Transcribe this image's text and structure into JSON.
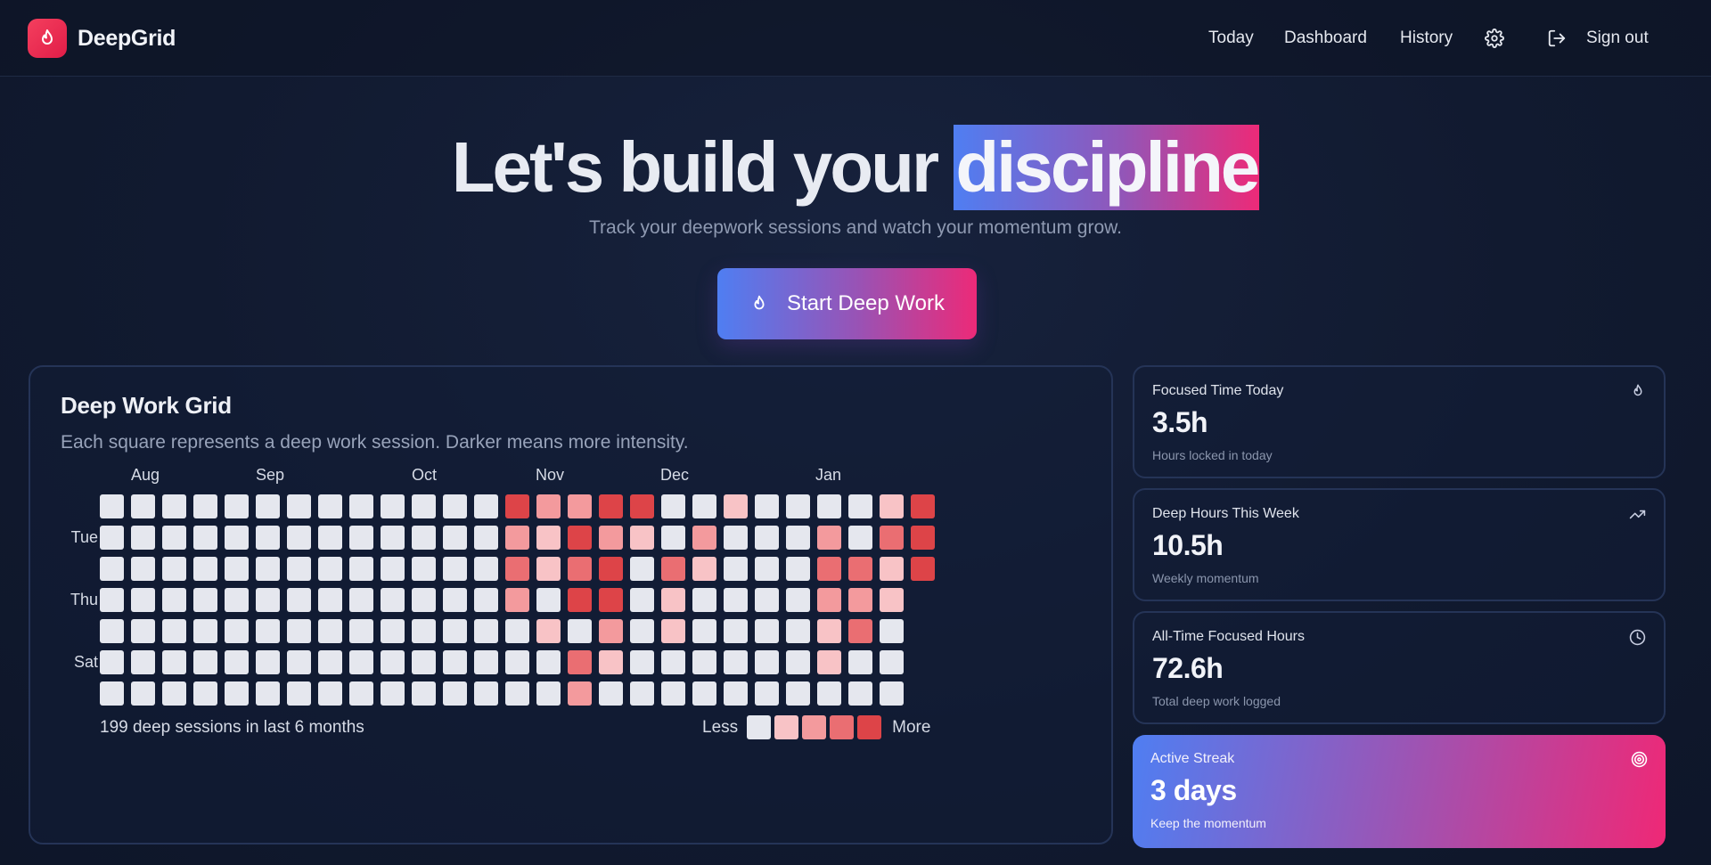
{
  "header": {
    "brand": "DeepGrid",
    "nav": [
      {
        "label": "Today"
      },
      {
        "label": "Dashboard"
      },
      {
        "label": "History"
      }
    ],
    "settings_icon": "gear-icon",
    "signout_icon": "sign-out-icon",
    "signout_label": "Sign out"
  },
  "hero": {
    "title_prefix": "Let's build your",
    "title_highlight": "discipline",
    "subtitle": "Track your deepwork sessions and watch your momentum grow.",
    "cta_label": "Start Deep Work",
    "cta_icon": "flame-icon"
  },
  "grid": {
    "title": "Deep Work Grid",
    "description": "Each square represents a deep work session. Darker means more intensity.",
    "months": [
      "Aug",
      "Sep",
      "Oct",
      "Nov",
      "Dec",
      "Jan"
    ],
    "day_labels": [
      "",
      "Tue",
      "",
      "Thu",
      "",
      "Sat",
      ""
    ],
    "summary": "199 deep sessions in last 6 months",
    "legend_less": "Less",
    "legend_more": "More",
    "levels": [
      "#e5e7ee",
      "#f8c3c6",
      "#f39a9d",
      "#ea6e72",
      "#dd4448"
    ],
    "weeks": [
      [
        0,
        0,
        0,
        0,
        0,
        0,
        0
      ],
      [
        0,
        0,
        0,
        0,
        0,
        0,
        0
      ],
      [
        0,
        0,
        0,
        0,
        0,
        0,
        0
      ],
      [
        0,
        0,
        0,
        0,
        0,
        0,
        0
      ],
      [
        0,
        0,
        0,
        0,
        0,
        0,
        0
      ],
      [
        0,
        0,
        0,
        0,
        0,
        0,
        0
      ],
      [
        0,
        0,
        0,
        0,
        0,
        0,
        0
      ],
      [
        0,
        0,
        0,
        0,
        0,
        0,
        0
      ],
      [
        0,
        0,
        0,
        0,
        0,
        0,
        0
      ],
      [
        0,
        0,
        0,
        0,
        0,
        0,
        0
      ],
      [
        0,
        0,
        0,
        0,
        0,
        0,
        0
      ],
      [
        0,
        0,
        0,
        0,
        0,
        0,
        0
      ],
      [
        0,
        0,
        0,
        0,
        0,
        0,
        0
      ],
      [
        4,
        2,
        3,
        2,
        0,
        0,
        0
      ],
      [
        2,
        1,
        1,
        0,
        1,
        0,
        0
      ],
      [
        2,
        4,
        3,
        4,
        0,
        3,
        2
      ],
      [
        4,
        2,
        4,
        4,
        2,
        1,
        0
      ],
      [
        4,
        1,
        0,
        0,
        0,
        0,
        0
      ],
      [
        0,
        0,
        3,
        1,
        1,
        0,
        0
      ],
      [
        0,
        2,
        1,
        0,
        0,
        0,
        0
      ],
      [
        1,
        0,
        0,
        0,
        0,
        0,
        0
      ],
      [
        0,
        0,
        0,
        0,
        0,
        0,
        0
      ],
      [
        0,
        0,
        0,
        0,
        0,
        0,
        0
      ],
      [
        0,
        2,
        3,
        2,
        1,
        1,
        0
      ],
      [
        0,
        0,
        3,
        2,
        3,
        0,
        0
      ],
      [
        1,
        3,
        1,
        1,
        0,
        0,
        0
      ],
      [
        4,
        4,
        4,
        null,
        null,
        null,
        null
      ]
    ]
  },
  "stats": [
    {
      "label": "Focused Time Today",
      "value": "3.5h",
      "sub": "Hours locked in today",
      "icon": "flame-icon"
    },
    {
      "label": "Deep Hours This Week",
      "value": "10.5h",
      "sub": "Weekly momentum",
      "icon": "trending-up-icon"
    },
    {
      "label": "All-Time Focused Hours",
      "value": "72.6h",
      "sub": "Total deep work logged",
      "icon": "clock-icon"
    },
    {
      "label": "Active Streak",
      "value": "3 days",
      "sub": "Keep the momentum",
      "icon": "target-icon"
    }
  ]
}
